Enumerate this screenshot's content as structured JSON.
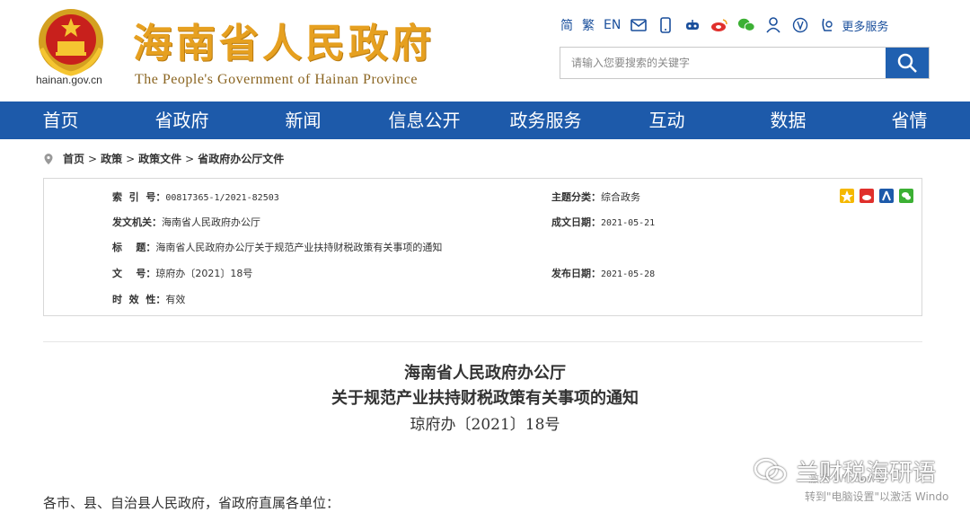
{
  "header": {
    "domain": "hainan.gov.cn",
    "title": "海南省人民政府",
    "subtitle": "The People's Government  of Hainan Province",
    "toolbar": {
      "lang_simplified": "简",
      "lang_traditional": "繁",
      "lang_english": "EN",
      "more_services": "更多服务"
    },
    "search": {
      "placeholder": "请输入您要搜索的关键字"
    }
  },
  "nav": {
    "items": [
      "首页",
      "省政府",
      "新闻",
      "信息公开",
      "政务服务",
      "互动",
      "数据",
      "省情"
    ]
  },
  "breadcrumb": {
    "items": [
      "首页",
      "政策",
      "政策文件",
      "省政府办公厅文件"
    ],
    "separator": ">"
  },
  "info": {
    "index_label": "索  引  号：",
    "index_value": "00817365-1/2021-82503",
    "issuer_label": "发文机关：",
    "issuer_value": "海南省人民政府办公厅",
    "title_label": "标    题：",
    "title_value": "海南省人民政府办公厅关于规范产业扶持财税政策有关事项的通知",
    "docno_label": "文    号：",
    "docno_value": "琼府办〔2021〕18号",
    "validity_label": "时  效  性：",
    "validity_value": "有效",
    "topic_label": "主题分类：",
    "topic_value": "综合政务",
    "created_label": "成文日期：",
    "created_value": "2021-05-21",
    "published_label": "发布日期：",
    "published_value": "2021-05-28"
  },
  "document": {
    "title_line1": "海南省人民政府办公厅",
    "title_line2": "关于规范产业扶持财税政策有关事项的通知",
    "number": "琼府办〔2021〕18号",
    "salutation": "各市、县、自治县人民政府，省政府直属各单位："
  },
  "overlay": {
    "watermark": "兰财税海研语",
    "windows_ghost": "激活 Windows",
    "windows_activate": "转到\"电脑设置\"以激活 Windo"
  },
  "colors": {
    "nav_bg": "#1d5aaa",
    "title_gold": "#e6a020",
    "link_blue": "#1a4f9c"
  }
}
